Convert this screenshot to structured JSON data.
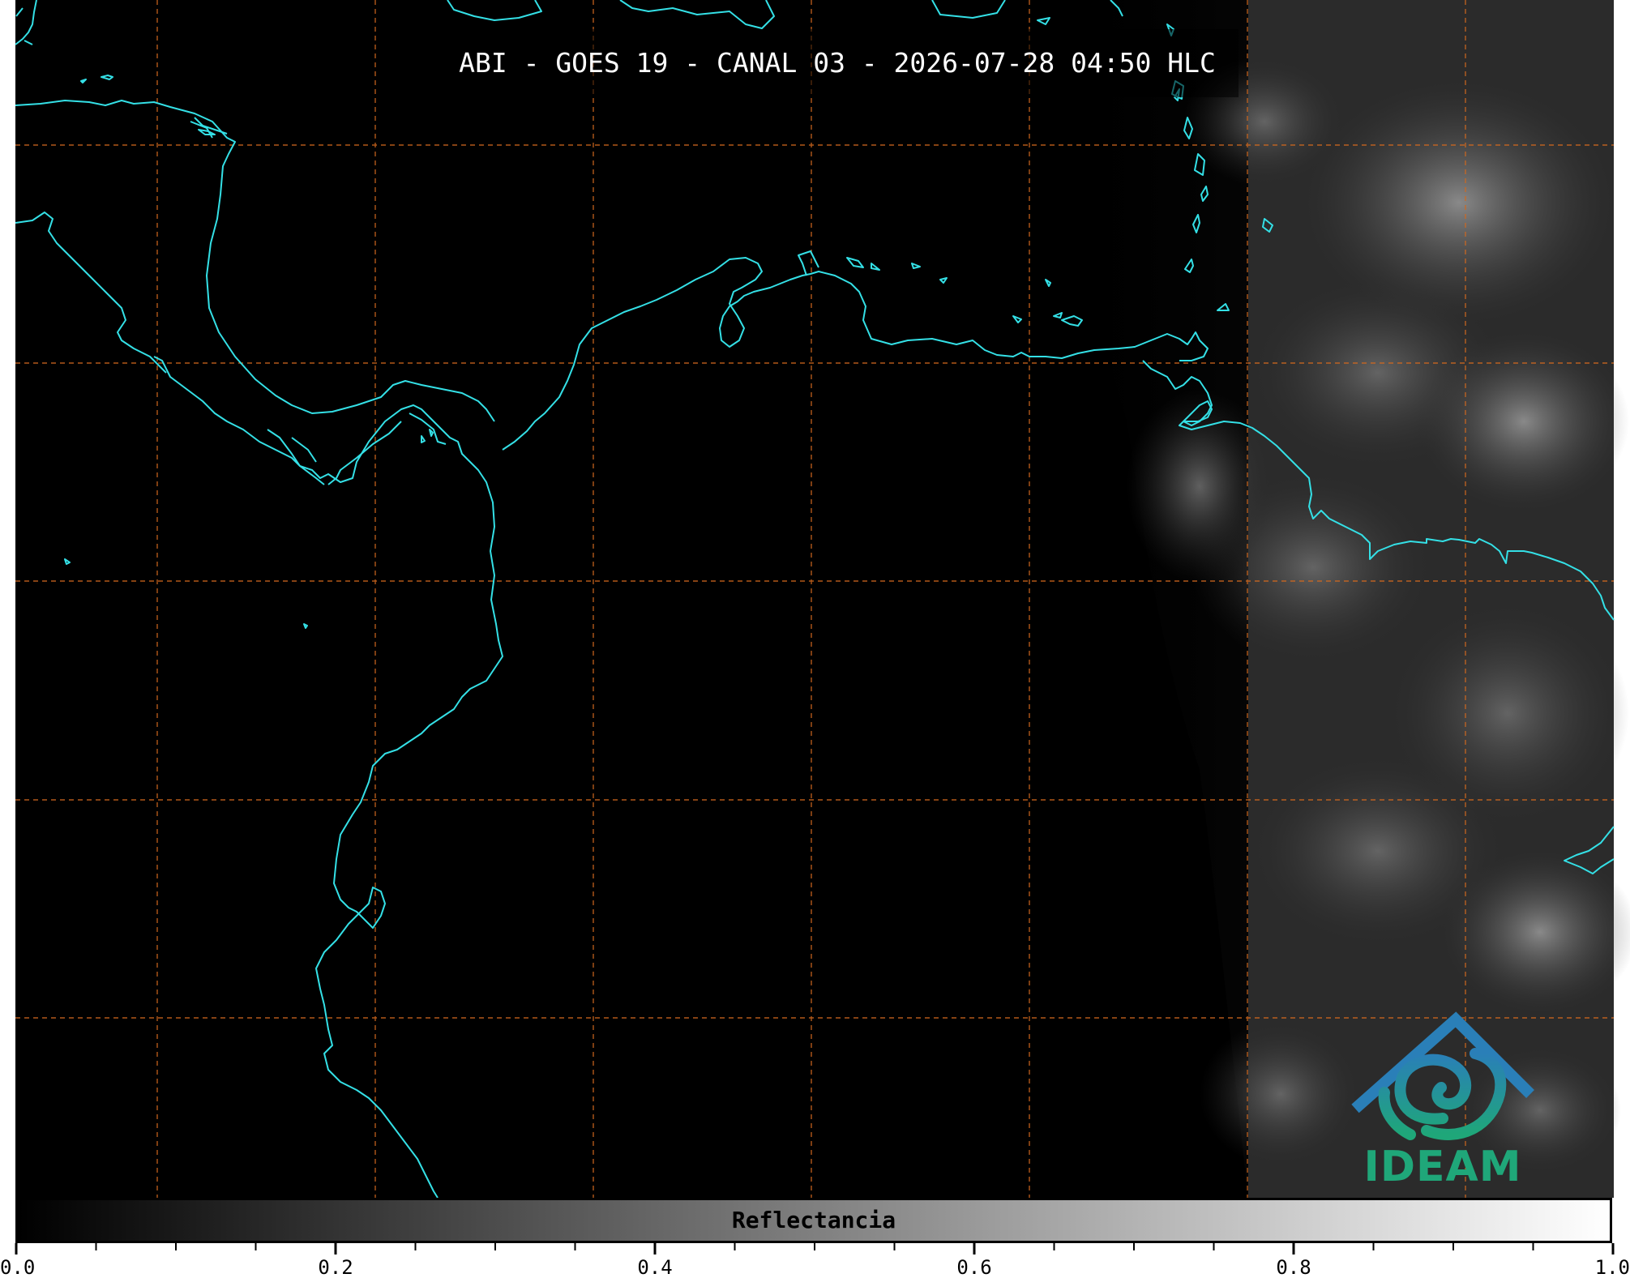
{
  "title": "ABI - GOES 19 - CANAL 03 - 2026-07-28 04:50 HLC",
  "colorbar": {
    "label": "Reflectancia",
    "ticks": [
      "0.0",
      "0.2",
      "0.4",
      "0.6",
      "0.8",
      "1.0"
    ],
    "min": 0.0,
    "max": 1.0,
    "cmap_start": "#000000",
    "cmap_end": "#ffffff"
  },
  "logo": {
    "text": "IDEAM",
    "primary_color": "#1fa779",
    "secondary_color": "#2a7fb8"
  },
  "colors": {
    "coastline": "#34e0e6",
    "gridline": "#d2691e",
    "background": "#000000"
  }
}
